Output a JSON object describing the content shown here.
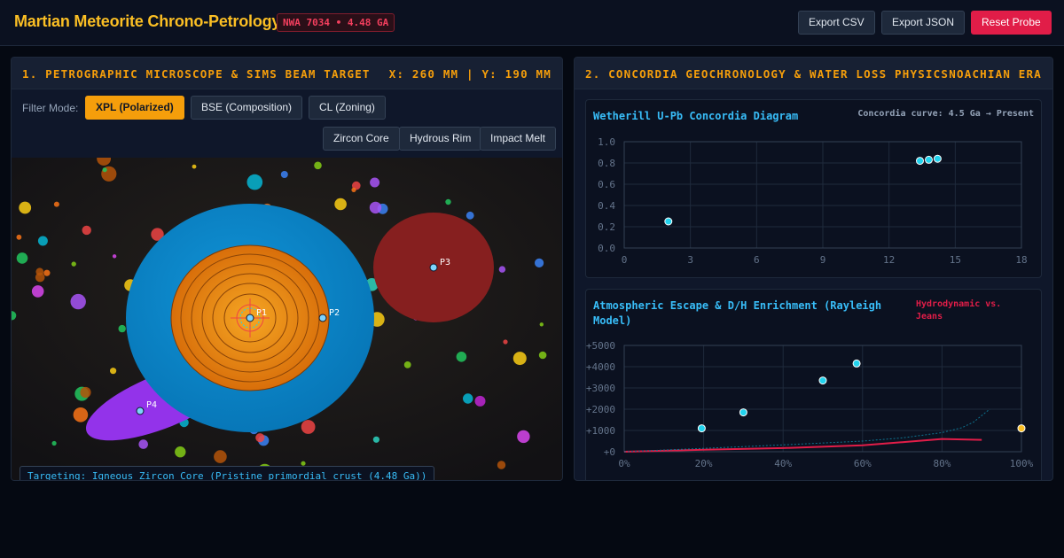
{
  "header": {
    "title": "Martian Meteorite Chrono-Petrology",
    "badge": "NWA 7034 • 4.48 GA",
    "buttons": {
      "export_csv": "Export CSV",
      "export_json": "Export JSON",
      "reset": "Reset Probe"
    }
  },
  "left_panel": {
    "title": "1. PETROGRAPHIC MICROSCOPE & SIMS BEAM TARGET",
    "coords": "X: 260 MM | Y: 190 MM",
    "filter_label": "Filter Mode:",
    "filters": [
      "XPL (Polarized)",
      "BSE (Composition)",
      "CL (Zoning)"
    ],
    "active_filter": "XPL (Polarized)",
    "targets": [
      "Zircon Core",
      "Hydrous Rim",
      "Impact Melt"
    ],
    "probes": [
      "P1",
      "P2",
      "P3",
      "P4"
    ],
    "targeting": "Targeting: Igneous Zircon Core (Pristine primordial crust (4.48 Ga))",
    "colors": {
      "zircon_core": "#e0780c",
      "zircon_rim": "#0a8fd4",
      "hydrous_inclusion": "#861f1f",
      "impact_melt": "#9333ea",
      "crosshair": "#ef4444"
    }
  },
  "right_panel": {
    "title": "2. CONCORDIA GEOCHRONOLOGY & WATER LOSS PHYSICS",
    "era": "NOACHIAN ERA"
  },
  "chart_data": [
    {
      "type": "scatter",
      "title": "Wetherill U-Pb Concordia Diagram",
      "note": "Concordia curve: 4.5 Ga → Present",
      "xlabel": "",
      "ylabel": "",
      "xlim": [
        0,
        18
      ],
      "ylim": [
        0,
        1.0
      ],
      "x_ticks": [
        "0",
        "3",
        "6",
        "9",
        "12",
        "15",
        "18"
      ],
      "y_ticks": [
        "0.0",
        "0.2",
        "0.4",
        "0.6",
        "0.8",
        "1.0"
      ],
      "grid": true,
      "points": [
        {
          "x": 2.0,
          "y": 0.25
        },
        {
          "x": 13.4,
          "y": 0.82
        },
        {
          "x": 13.8,
          "y": 0.83
        },
        {
          "x": 14.2,
          "y": 0.84
        }
      ],
      "colors": {
        "point": "#22d3ee"
      }
    },
    {
      "type": "line",
      "title": "Atmospheric Escape & D/H Enrichment (Rayleigh Model)",
      "note": "Hydrodynamic vs. Jeans",
      "xlabel": "",
      "ylabel": "",
      "xlim": [
        0,
        100
      ],
      "ylim": [
        0,
        5000
      ],
      "x_ticks": [
        "0%",
        "20%",
        "40%",
        "60%",
        "80%",
        "100%"
      ],
      "y_ticks": [
        "+0",
        "+1000",
        "+2000",
        "+3000",
        "+4000",
        "+5000"
      ],
      "grid": true,
      "series": [
        {
          "style": "solid",
          "color": "#e11d48",
          "x": [
            0,
            20,
            40,
            60,
            70,
            80,
            90
          ],
          "y": [
            0,
            90,
            170,
            300,
            450,
            600,
            560
          ]
        },
        {
          "style": "dotted",
          "color": "#0e7490",
          "x": [
            0,
            20,
            40,
            60,
            70,
            80,
            85,
            88,
            90,
            92
          ],
          "y": [
            0,
            160,
            320,
            500,
            650,
            900,
            1130,
            1400,
            1700,
            2000
          ]
        }
      ],
      "points": [
        {
          "x": 19.5,
          "y": 1100,
          "color": "#22d3ee"
        },
        {
          "x": 30,
          "y": 1850,
          "color": "#22d3ee"
        },
        {
          "x": 50,
          "y": 3350,
          "color": "#22d3ee"
        },
        {
          "x": 58.5,
          "y": 4150,
          "color": "#22d3ee"
        },
        {
          "x": 100,
          "y": 1100,
          "color": "#fbbf24"
        }
      ]
    }
  ]
}
